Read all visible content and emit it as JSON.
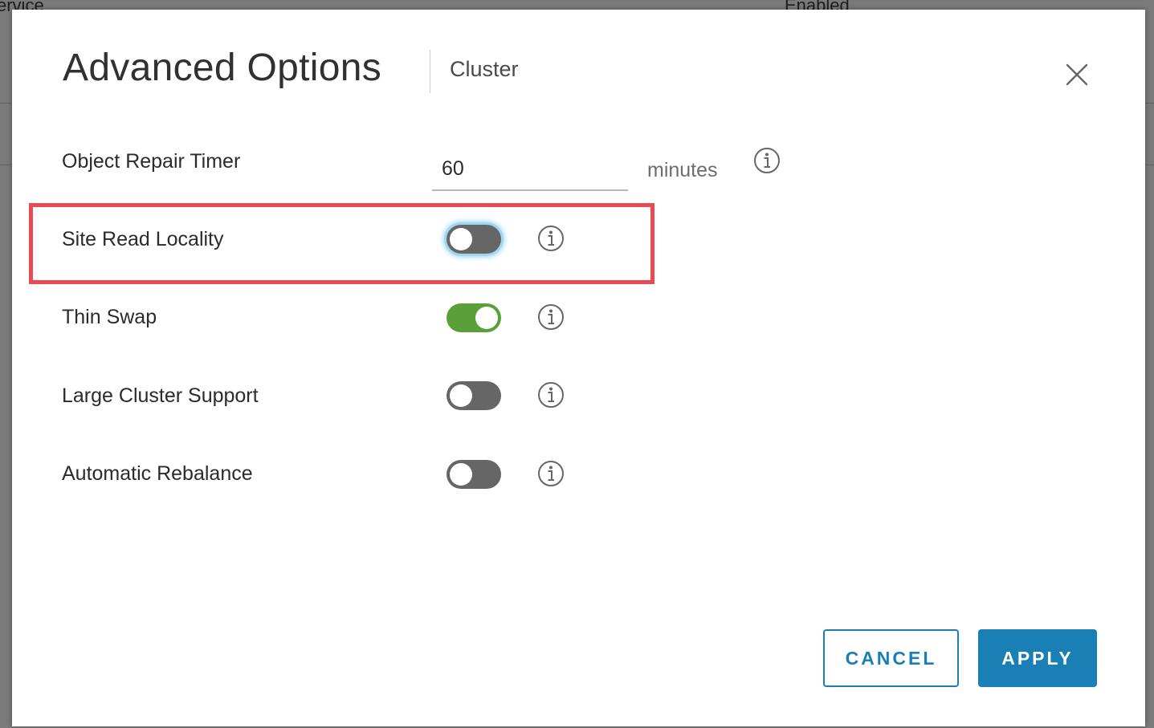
{
  "backdrop": {
    "fragment_left": "ervice",
    "fragment_right": "Enabled"
  },
  "dialog": {
    "title": "Advanced Options",
    "subtitle": "Cluster",
    "close_icon": "close-icon"
  },
  "options": {
    "object_repair_timer": {
      "label": "Object Repair Timer",
      "value": "60",
      "unit": "minutes",
      "info_icon": "info-icon"
    },
    "site_read_locality": {
      "label": "Site Read Locality",
      "enabled": false,
      "highlighted": true,
      "highlight_color": "#ea4b52"
    },
    "thin_swap": {
      "label": "Thin Swap",
      "enabled": true
    },
    "large_cluster_support": {
      "label": "Large Cluster Support",
      "enabled": false
    },
    "automatic_rebalance": {
      "label": "Automatic Rebalance",
      "enabled": false
    }
  },
  "buttons": {
    "cancel_label": "CANCEL",
    "apply_label": "APPLY"
  },
  "colors": {
    "toggle_on": "#5aa038",
    "toggle_off": "#666666",
    "primary": "#1a7fb5"
  }
}
